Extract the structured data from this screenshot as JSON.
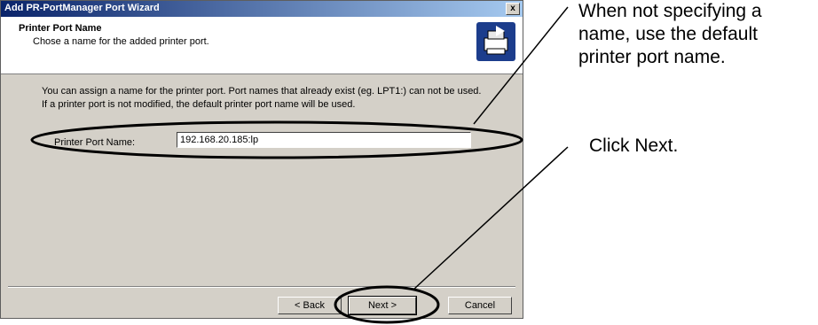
{
  "window": {
    "title": "Add PR-PortManager Port Wizard",
    "close_label": "x"
  },
  "header": {
    "title": "Printer Port Name",
    "subtitle": "Chose a name for the added printer port."
  },
  "content": {
    "description_line1": "You can assign a name for the printer port. Port names that already exist (eg. LPT1:) can not be used.",
    "description_line2": "If a printer port is not modified, the default printer port name will be used.",
    "port_name_label": "Printer Port Name:",
    "port_name_value": "192.168.20.185:lp"
  },
  "buttons": {
    "back": "< Back",
    "next": "Next >",
    "cancel": "Cancel"
  },
  "annotations": {
    "note1_line1": "When not specifying a",
    "note1_line2": "name, use the default",
    "note1_line3": "printer port name.",
    "note2": "Click Next."
  }
}
